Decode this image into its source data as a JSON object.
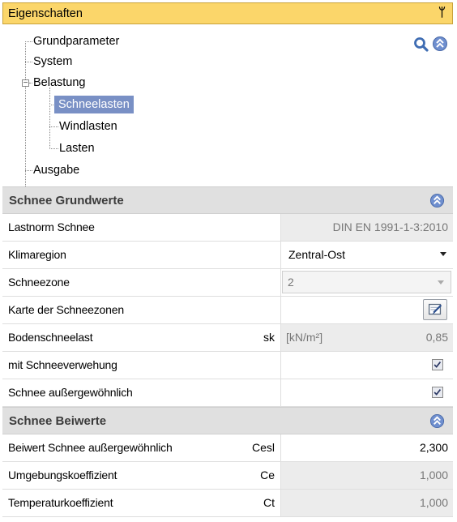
{
  "panel": {
    "title": "Eigenschaften",
    "pin_glyph": "ᛘ"
  },
  "tree": {
    "items": [
      {
        "label": "Grundparameter"
      },
      {
        "label": "System"
      },
      {
        "label": "Belastung"
      },
      {
        "label": "Schneelasten",
        "selected": true
      },
      {
        "label": "Windlasten"
      },
      {
        "label": "Lasten"
      },
      {
        "label": "Ausgabe"
      }
    ],
    "expander_glyph": "−"
  },
  "icons": {
    "search": "search-icon",
    "collapse": "collapse-icon",
    "edit": "map-edit-icon",
    "check": "checkmark-icon",
    "accent": "#5a7fc1"
  },
  "sections": {
    "grund": {
      "title": "Schnee Grundwerte",
      "rows": {
        "lastnorm": {
          "label": "Lastnorm Schnee",
          "value": "DIN EN 1991-1-3:2010"
        },
        "klimaregion": {
          "label": "Klimaregion",
          "value": "Zentral-Ost"
        },
        "schneezone": {
          "label": "Schneezone",
          "value": "2"
        },
        "karte": {
          "label": "Karte der Schneezonen"
        },
        "boden": {
          "label": "Bodenschneelast",
          "symbol": "sk",
          "unit": "[kN/m²]",
          "value": "0,85"
        },
        "verwehung": {
          "label": "mit Schneeverwehung",
          "checked": true
        },
        "ausserg": {
          "label": "Schnee außergewöhnlich",
          "checked": true
        }
      }
    },
    "beiwerte": {
      "title": "Schnee Beiwerte",
      "rows": {
        "cesl": {
          "label": "Beiwert Schnee außergewöhnlich",
          "symbol": "Cesl",
          "value": "2,300"
        },
        "ce": {
          "label": "Umgebungskoeffizient",
          "symbol": "Ce",
          "value": "1,000"
        },
        "ct": {
          "label": "Temperaturkoeffizient",
          "symbol": "Ct",
          "value": "1,000"
        }
      }
    }
  }
}
